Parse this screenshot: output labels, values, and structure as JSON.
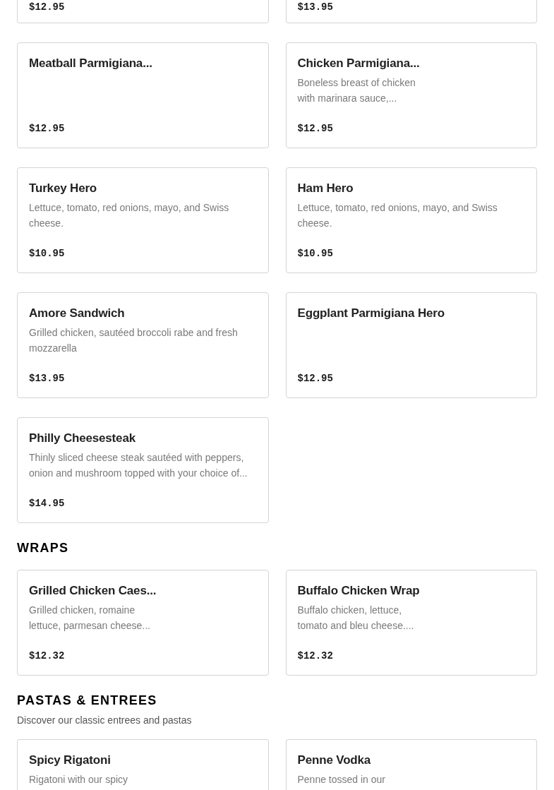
{
  "sections": [
    {
      "items": [
        {
          "price": "$12.95"
        },
        {
          "price": "$13.95"
        },
        {
          "name": "Meatball Parmigiana...",
          "price": "$12.95"
        },
        {
          "name": "Chicken Parmigiana...",
          "description": "Boneless breast of chicken\nwith marinara sauce,...",
          "price": "$12.95"
        },
        {
          "name": "Turkey Hero",
          "description": "Lettuce, tomato, red onions, mayo, and Swiss\ncheese.",
          "price": "$10.95"
        },
        {
          "name": "Ham Hero",
          "description": "Lettuce, tomato, red onions, mayo, and Swiss\ncheese.",
          "price": "$10.95"
        },
        {
          "name": "Amore Sandwich",
          "description": "Grilled chicken, sautéed broccoli rabe and fresh\nmozzarella",
          "price": "$13.95"
        },
        {
          "name": "Eggplant Parmigiana Hero",
          "price": "$12.95"
        },
        {
          "name": "Philly Cheesesteak",
          "description": "Thinly sliced cheese steak sautéed with peppers,\nonion and mushroom topped with your choice of...",
          "price": "$14.95"
        }
      ]
    },
    {
      "title": "WRAPS",
      "items": [
        {
          "name": "Grilled Chicken Caes...",
          "description": "Grilled chicken, romaine\nlettuce, parmesan cheese...",
          "price": "$12.32"
        },
        {
          "name": "Buffalo Chicken Wrap",
          "description": "Buffalo chicken, lettuce,\ntomato and bleu cheese....",
          "price": "$12.32"
        }
      ]
    },
    {
      "title": "PASTAS & ENTREES",
      "subtitle": "Discover our classic entrees and pastas",
      "items": [
        {
          "name": "Spicy Rigatoni",
          "description": "Rigatoni with our spicy"
        },
        {
          "name": "Penne Vodka",
          "description": "Penne tossed in our"
        }
      ]
    }
  ]
}
